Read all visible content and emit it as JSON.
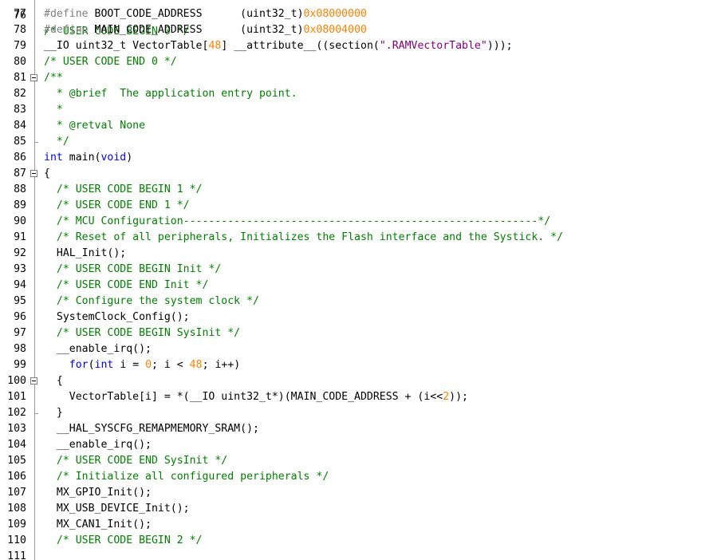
{
  "editor": {
    "name": "source-code-editor",
    "first_line_partial": {
      "number": "76",
      "text": "/* USER CODE BEGIN 0 */"
    },
    "lines": [
      {
        "number": "77",
        "segments": [
          {
            "t": "#define ",
            "c": "pp"
          },
          {
            "t": "BOOT_CODE_ADDRESS      (uint32_t)",
            "c": ""
          },
          {
            "t": "0x08000000",
            "c": "num"
          }
        ]
      },
      {
        "number": "78",
        "segments": [
          {
            "t": "#define ",
            "c": "pp"
          },
          {
            "t": "MAIN_CODE_ADDRESS      (uint32_t)",
            "c": ""
          },
          {
            "t": "0x08004000",
            "c": "num"
          }
        ]
      },
      {
        "number": "79",
        "segments": [
          {
            "t": "__IO uint32_t VectorTable[",
            "c": ""
          },
          {
            "t": "48",
            "c": "num"
          },
          {
            "t": "] __attribute__((section(",
            "c": ""
          },
          {
            "t": "\".RAMVectorTable\"",
            "c": "str"
          },
          {
            "t": ")));",
            "c": ""
          }
        ]
      },
      {
        "number": "80",
        "segments": [
          {
            "t": "/* USER CODE END 0 */",
            "c": "cm"
          }
        ]
      },
      {
        "number": "81",
        "fold": "open",
        "segments": [
          {
            "t": "/**",
            "c": "cm"
          }
        ]
      },
      {
        "number": "82",
        "segments": [
          {
            "t": "  * @brief  The application entry point.",
            "c": "cm"
          }
        ]
      },
      {
        "number": "83",
        "segments": [
          {
            "t": "  *",
            "c": "cm"
          }
        ]
      },
      {
        "number": "84",
        "segments": [
          {
            "t": "  * @retval None",
            "c": "cm"
          }
        ]
      },
      {
        "number": "85",
        "fold": "end",
        "segments": [
          {
            "t": "  */",
            "c": "cm"
          }
        ]
      },
      {
        "number": "86",
        "segments": [
          {
            "t": "int",
            "c": "kw"
          },
          {
            "t": " main(",
            "c": ""
          },
          {
            "t": "void",
            "c": "kw"
          },
          {
            "t": ")",
            "c": ""
          }
        ]
      },
      {
        "number": "87",
        "fold": "open",
        "segments": [
          {
            "t": "{",
            "c": ""
          }
        ]
      },
      {
        "number": "88",
        "segments": [
          {
            "t": "  /* USER CODE BEGIN 1 */",
            "c": "cm"
          }
        ]
      },
      {
        "number": "89",
        "segments": [
          {
            "t": "  /* USER CODE END 1 */",
            "c": "cm"
          }
        ]
      },
      {
        "number": "90",
        "segments": [
          {
            "t": "  /* MCU Configuration--------------------------------------------------------*/",
            "c": "cm"
          }
        ]
      },
      {
        "number": "91",
        "segments": [
          {
            "t": "  /* Reset of all peripherals, Initializes the Flash interface and the Systick. */",
            "c": "cm"
          }
        ]
      },
      {
        "number": "92",
        "segments": [
          {
            "t": "  HAL_Init();",
            "c": ""
          }
        ]
      },
      {
        "number": "93",
        "segments": [
          {
            "t": "  /* USER CODE BEGIN Init */",
            "c": "cm"
          }
        ]
      },
      {
        "number": "94",
        "segments": [
          {
            "t": "  /* USER CODE END Init */",
            "c": "cm"
          }
        ]
      },
      {
        "number": "95",
        "segments": [
          {
            "t": "  /* Configure the system clock */",
            "c": "cm"
          }
        ]
      },
      {
        "number": "96",
        "segments": [
          {
            "t": "  SystemClock_Config();",
            "c": ""
          }
        ]
      },
      {
        "number": "97",
        "segments": [
          {
            "t": "  /* USER CODE BEGIN SysInit */",
            "c": "cm"
          }
        ]
      },
      {
        "number": "98",
        "segments": [
          {
            "t": "  __enable_irq();",
            "c": ""
          }
        ]
      },
      {
        "number": "99",
        "segments": [
          {
            "t": "    ",
            "c": ""
          },
          {
            "t": "for",
            "c": "kw"
          },
          {
            "t": "(",
            "c": ""
          },
          {
            "t": "int",
            "c": "kw"
          },
          {
            "t": " i = ",
            "c": ""
          },
          {
            "t": "0",
            "c": "num"
          },
          {
            "t": "; i < ",
            "c": ""
          },
          {
            "t": "48",
            "c": "num"
          },
          {
            "t": "; i++)",
            "c": ""
          }
        ]
      },
      {
        "number": "100",
        "fold": "open",
        "segments": [
          {
            "t": "  {",
            "c": ""
          }
        ]
      },
      {
        "number": "101",
        "segments": [
          {
            "t": "    VectorTable[i] = *(__IO uint32_t*)(MAIN_CODE_ADDRESS + (i<<",
            "c": ""
          },
          {
            "t": "2",
            "c": "num"
          },
          {
            "t": "));",
            "c": ""
          }
        ]
      },
      {
        "number": "102",
        "fold": "end",
        "segments": [
          {
            "t": "  }",
            "c": ""
          }
        ]
      },
      {
        "number": "103",
        "segments": [
          {
            "t": "  __HAL_SYSCFG_REMAPMEMORY_SRAM();",
            "c": ""
          }
        ]
      },
      {
        "number": "104",
        "segments": [
          {
            "t": "  __enable_irq();",
            "c": ""
          }
        ]
      },
      {
        "number": "105",
        "segments": [
          {
            "t": "  /* USER CODE END SysInit */",
            "c": "cm"
          }
        ]
      },
      {
        "number": "106",
        "segments": [
          {
            "t": "  /* Initialize all configured peripherals */",
            "c": "cm"
          }
        ]
      },
      {
        "number": "107",
        "segments": [
          {
            "t": "  MX_GPIO_Init();",
            "c": ""
          }
        ]
      },
      {
        "number": "108",
        "segments": [
          {
            "t": "  MX_USB_DEVICE_Init();",
            "c": ""
          }
        ]
      },
      {
        "number": "109",
        "segments": [
          {
            "t": "  MX_CAN1_Init();",
            "c": ""
          }
        ]
      },
      {
        "number": "110",
        "segments": [
          {
            "t": "  /* USER CODE BEGIN 2 */",
            "c": "cm"
          }
        ]
      },
      {
        "number": "111",
        "segments": []
      }
    ]
  }
}
